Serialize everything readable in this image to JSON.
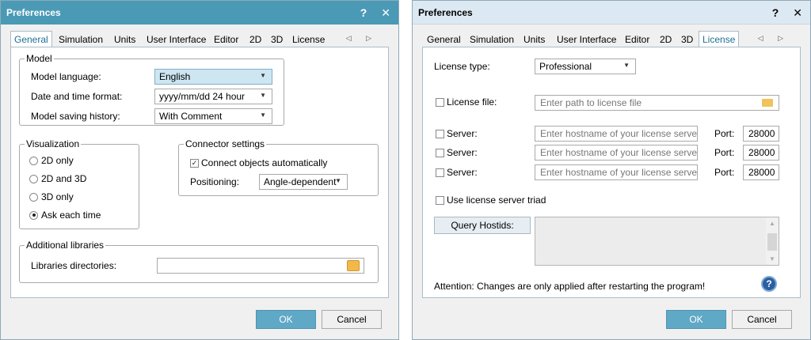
{
  "left": {
    "title": "Preferences",
    "help": "?",
    "close": "✕",
    "tabs": [
      "General",
      "Simulation",
      "Units",
      "User Interface",
      "Editor",
      "2D",
      "3D",
      "License"
    ],
    "tab_arrows": "◁ ▷",
    "model": {
      "title": "Model",
      "language_label": "Model language:",
      "language_value": "English",
      "datetime_label": "Date and time format:",
      "datetime_value": "yyyy/mm/dd  24 hour",
      "history_label": "Model saving history:",
      "history_value": "With Comment"
    },
    "visualization": {
      "title": "Visualization",
      "options": [
        "2D only",
        "2D and 3D",
        "3D only",
        "Ask each time"
      ],
      "selected": "Ask each time"
    },
    "connector": {
      "title": "Connector settings",
      "connect_label": "Connect objects automatically",
      "connect_checked": true,
      "positioning_label": "Positioning:",
      "positioning_value": "Angle-dependent"
    },
    "libraries": {
      "title": "Additional libraries",
      "dirs_label": "Libraries directories:",
      "dirs_value": ""
    },
    "ok": "OK",
    "cancel": "Cancel"
  },
  "right": {
    "title": "Preferences",
    "help": "?",
    "close": "✕",
    "tabs": [
      "General",
      "Simulation",
      "Units",
      "User Interface",
      "Editor",
      "2D",
      "3D",
      "License"
    ],
    "tab_arrows": "◁ ▷",
    "license_type_label": "License type:",
    "license_type_value": "Professional",
    "license_file_label": "License file:",
    "license_file_placeholder": "Enter path to license file",
    "servers": [
      {
        "label": "Server:",
        "placeholder": "Enter hostname of your license server",
        "port_label": "Port:",
        "port": "28000"
      },
      {
        "label": "Server:",
        "placeholder": "Enter hostname of your license server",
        "port_label": "Port:",
        "port": "28000"
      },
      {
        "label": "Server:",
        "placeholder": "Enter hostname of your license server",
        "port_label": "Port:",
        "port": "28000"
      }
    ],
    "triad_label": "Use license server triad",
    "query_label": "Query Hostids:",
    "attention": "Attention: Changes are only applied after restarting the program!",
    "help_icon": "?",
    "ok": "OK",
    "cancel": "Cancel"
  }
}
